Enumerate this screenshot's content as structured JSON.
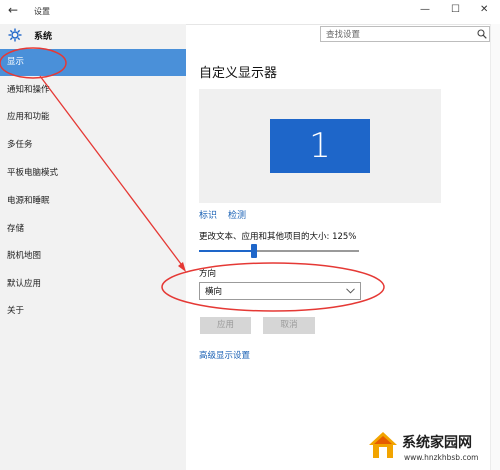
{
  "window": {
    "title": "设置",
    "controls": {
      "back": "←",
      "minimize": "—",
      "maximize": "☐",
      "close": "✕"
    }
  },
  "header": {
    "section_title": "系统",
    "search_placeholder": "查找设置"
  },
  "sidebar": {
    "items": [
      {
        "label": "显示",
        "selected": true
      },
      {
        "label": "通知和操作"
      },
      {
        "label": "应用和功能"
      },
      {
        "label": "多任务"
      },
      {
        "label": "平板电脑模式"
      },
      {
        "label": "电源和睡眠"
      },
      {
        "label": "存储"
      },
      {
        "label": "脱机地图"
      },
      {
        "label": "默认应用"
      },
      {
        "label": "关于"
      }
    ]
  },
  "main": {
    "page_title": "自定义显示器",
    "monitor_number": "1",
    "links": {
      "identify": "标识",
      "detect": "检测"
    },
    "scale_label": "更改文本、应用和其他项目的大小: 125%",
    "scale_value_percent": 125,
    "orientation": {
      "label": "方向",
      "value": "横向"
    },
    "buttons": {
      "apply": "应用",
      "cancel": "取消"
    },
    "advanced_link": "高级显示设置"
  },
  "colors": {
    "accent": "#1e66c9",
    "selected_nav": "#4a90d9",
    "annotation_red": "#e53935"
  },
  "watermark": {
    "brand": "系统家园网",
    "url": "www.hnzkhbsb.com"
  }
}
